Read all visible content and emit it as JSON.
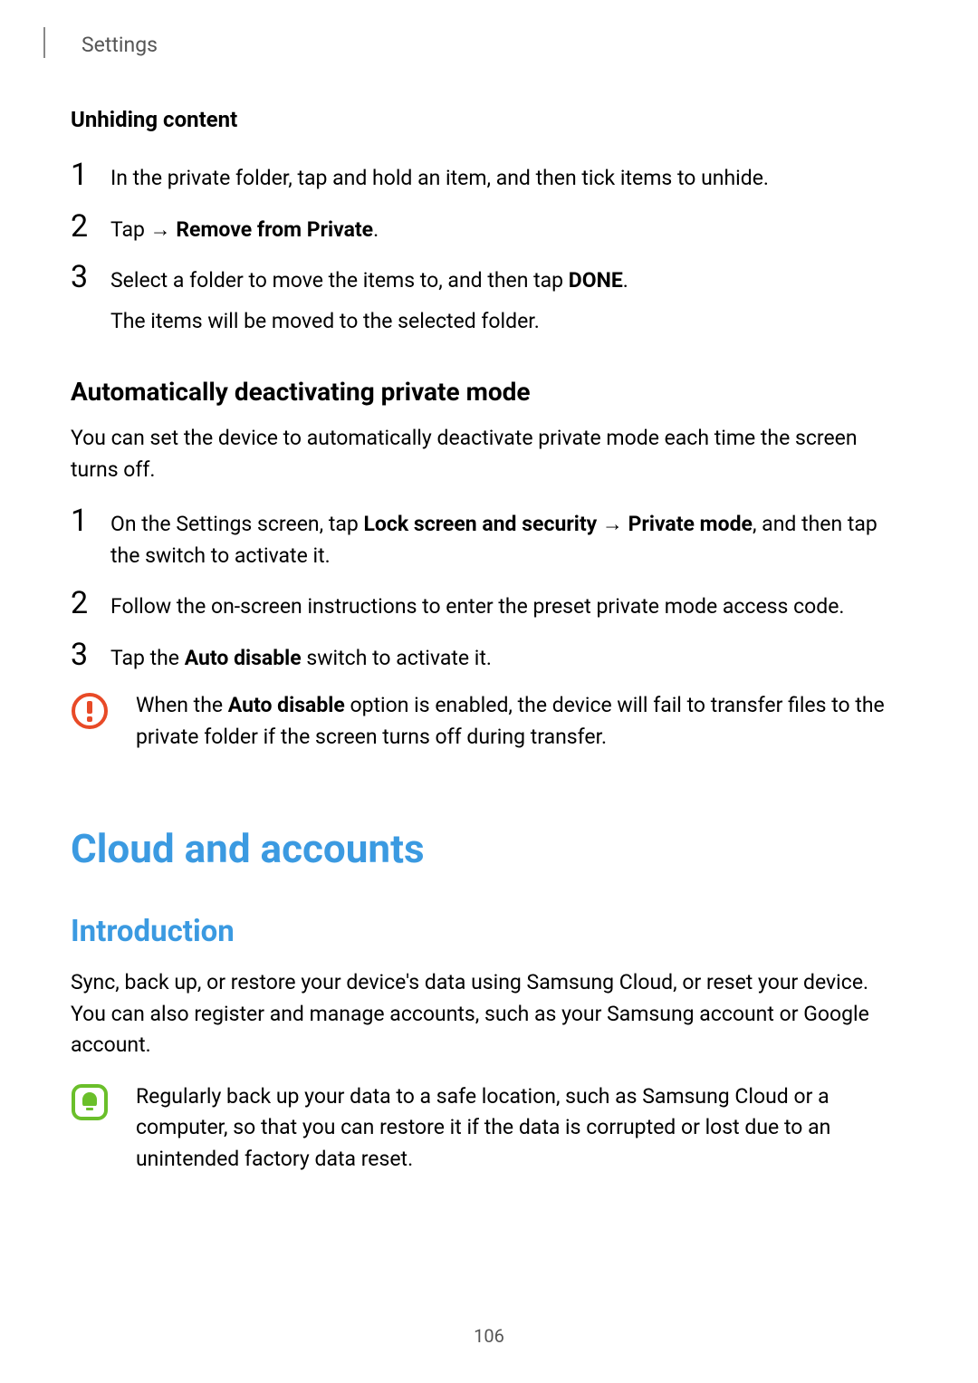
{
  "header": {
    "title": "Settings"
  },
  "unhiding": {
    "heading": "Unhiding content",
    "item1": "In the private folder, tap and hold an item, and then tick items to unhide.",
    "item2_prefix": "Tap ",
    "item2_arrow": "→ ",
    "item2_bold": "Remove from Private",
    "item2_suffix": ".",
    "item3_line1_prefix": "Select a folder to move the items to, and then tap ",
    "item3_line1_bold": "DONE",
    "item3_line1_suffix": ".",
    "item3_line2": "The items will be moved to the selected folder."
  },
  "auto": {
    "heading": "Automatically deactivating private mode",
    "intro": "You can set the device to automatically deactivate private mode each time the screen turns off.",
    "item1_prefix": "On the Settings screen, tap ",
    "item1_bold1": "Lock screen and security",
    "item1_arrow": " → ",
    "item1_bold2": "Private mode",
    "item1_suffix": ", and then tap the switch to activate it.",
    "item2": "Follow the on-screen instructions to enter the preset private mode access code.",
    "item3_prefix": "Tap the ",
    "item3_bold": "Auto disable",
    "item3_suffix": " switch to activate it.",
    "warn_prefix": "When the ",
    "warn_bold": "Auto disable",
    "warn_suffix": " option is enabled, the device will fail to transfer files to the private folder if the screen turns off during transfer."
  },
  "cloud": {
    "title": "Cloud and accounts",
    "intro_heading": "Introduction",
    "intro_para": "Sync, back up, or restore your device's data using Samsung Cloud, or reset your device. You can also register and manage accounts, such as your Samsung account or Google account.",
    "tip": "Regularly back up your data to a safe location, such as Samsung Cloud or a computer, so that you can restore it if the data is corrupted or lost due to an unintended factory data reset."
  },
  "nums": {
    "n1": "1",
    "n2": "2",
    "n3": "3"
  },
  "page_number": "106"
}
